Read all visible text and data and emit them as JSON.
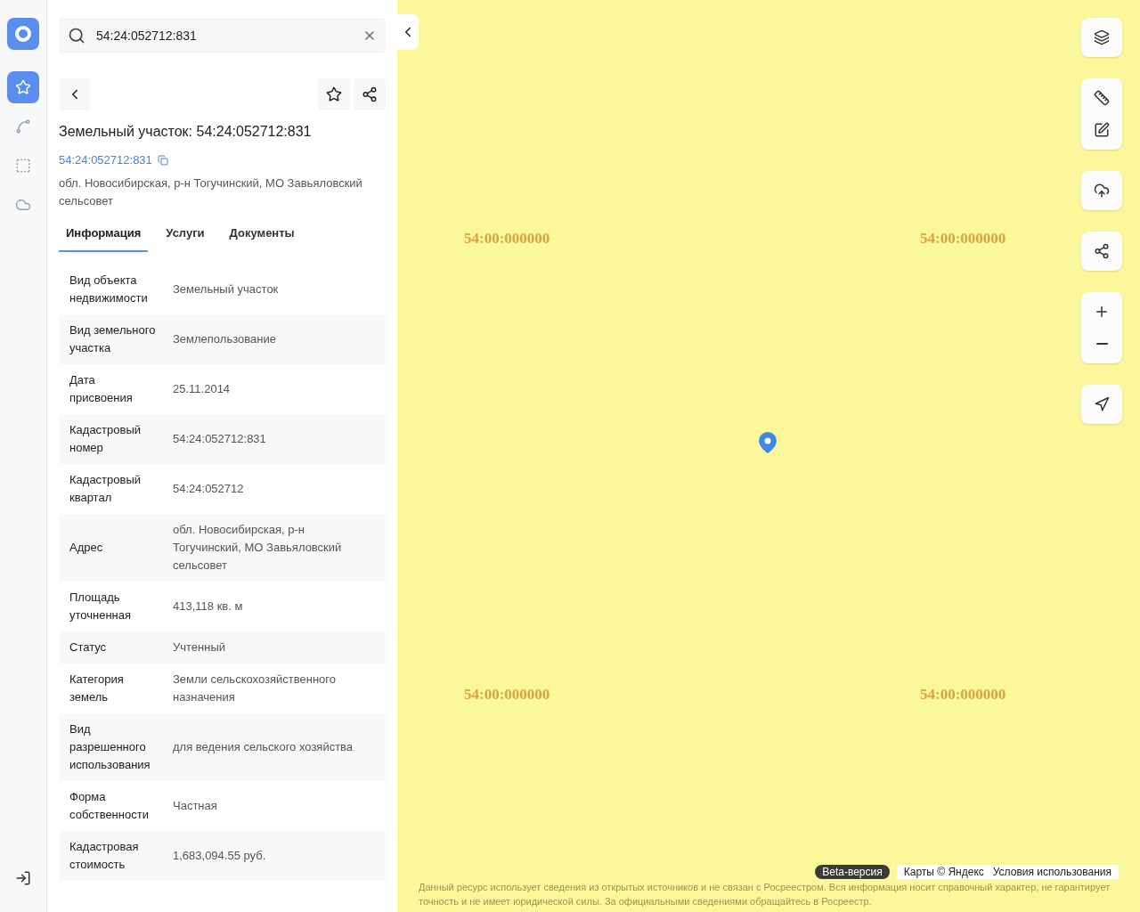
{
  "rail": {
    "items": [
      {
        "kind": "favorites",
        "selected": true
      },
      {
        "kind": "polygon",
        "selected": false
      },
      {
        "kind": "selection",
        "selected": false
      },
      {
        "kind": "cloud",
        "selected": false
      }
    ]
  },
  "search": {
    "value": "54:24:052712:831"
  },
  "object": {
    "title": "Земельный участок: 54:24:052712:831",
    "number": "54:24:052712:831",
    "address": "обл. Новосибирская, р-н Тогучинский, МО Завьяловский сельсовет"
  },
  "tabs": [
    {
      "label": "Информация",
      "selected": true
    },
    {
      "label": "Услуги",
      "selected": false
    },
    {
      "label": "Документы",
      "selected": false
    }
  ],
  "info": [
    {
      "label": "Вид объекта недвижимости",
      "value": "Земельный участок"
    },
    {
      "label": "Вид земельного участка",
      "value": "Землепользование"
    },
    {
      "label": "Дата присвоения",
      "value": "25.11.2014"
    },
    {
      "label": "Кадастровый номер",
      "value": "54:24:052712:831"
    },
    {
      "label": "Кадастровый квартал",
      "value": "54:24:052712"
    },
    {
      "label": "Адрес",
      "value": "обл. Новосибирская, р-н Тогучинский, МО Завьяловский сельсовет"
    },
    {
      "label": "Площадь уточненная",
      "value": "413,118 кв. м"
    },
    {
      "label": "Статус",
      "value": "Учтенный"
    },
    {
      "label": "Категория земель",
      "value": "Земли сельскохозяйственного назначения"
    },
    {
      "label": "Вид разрешенного использования",
      "value": "для ведения сельского хозяйства"
    },
    {
      "label": "Форма собственности",
      "value": "Частная"
    },
    {
      "label": "Кадастровая стоимость",
      "value": "1,683,094.55 руб."
    }
  ],
  "map": {
    "labels": [
      "54:00:000000",
      "54:00:000000",
      "54:00:000000",
      "54:00:000000"
    ],
    "badge": "Beta-версия",
    "attribution": "Карты © Яндекс",
    "terms": "Условия использования",
    "disclaimer": "Данный ресурс использует сведения из открытых источников и не связан с Росреестром. Вся информация носит справочный характер, не гарантирует точность и не имеет юридической силы. За официальными сведениями обращайтесь в Росреестр."
  }
}
